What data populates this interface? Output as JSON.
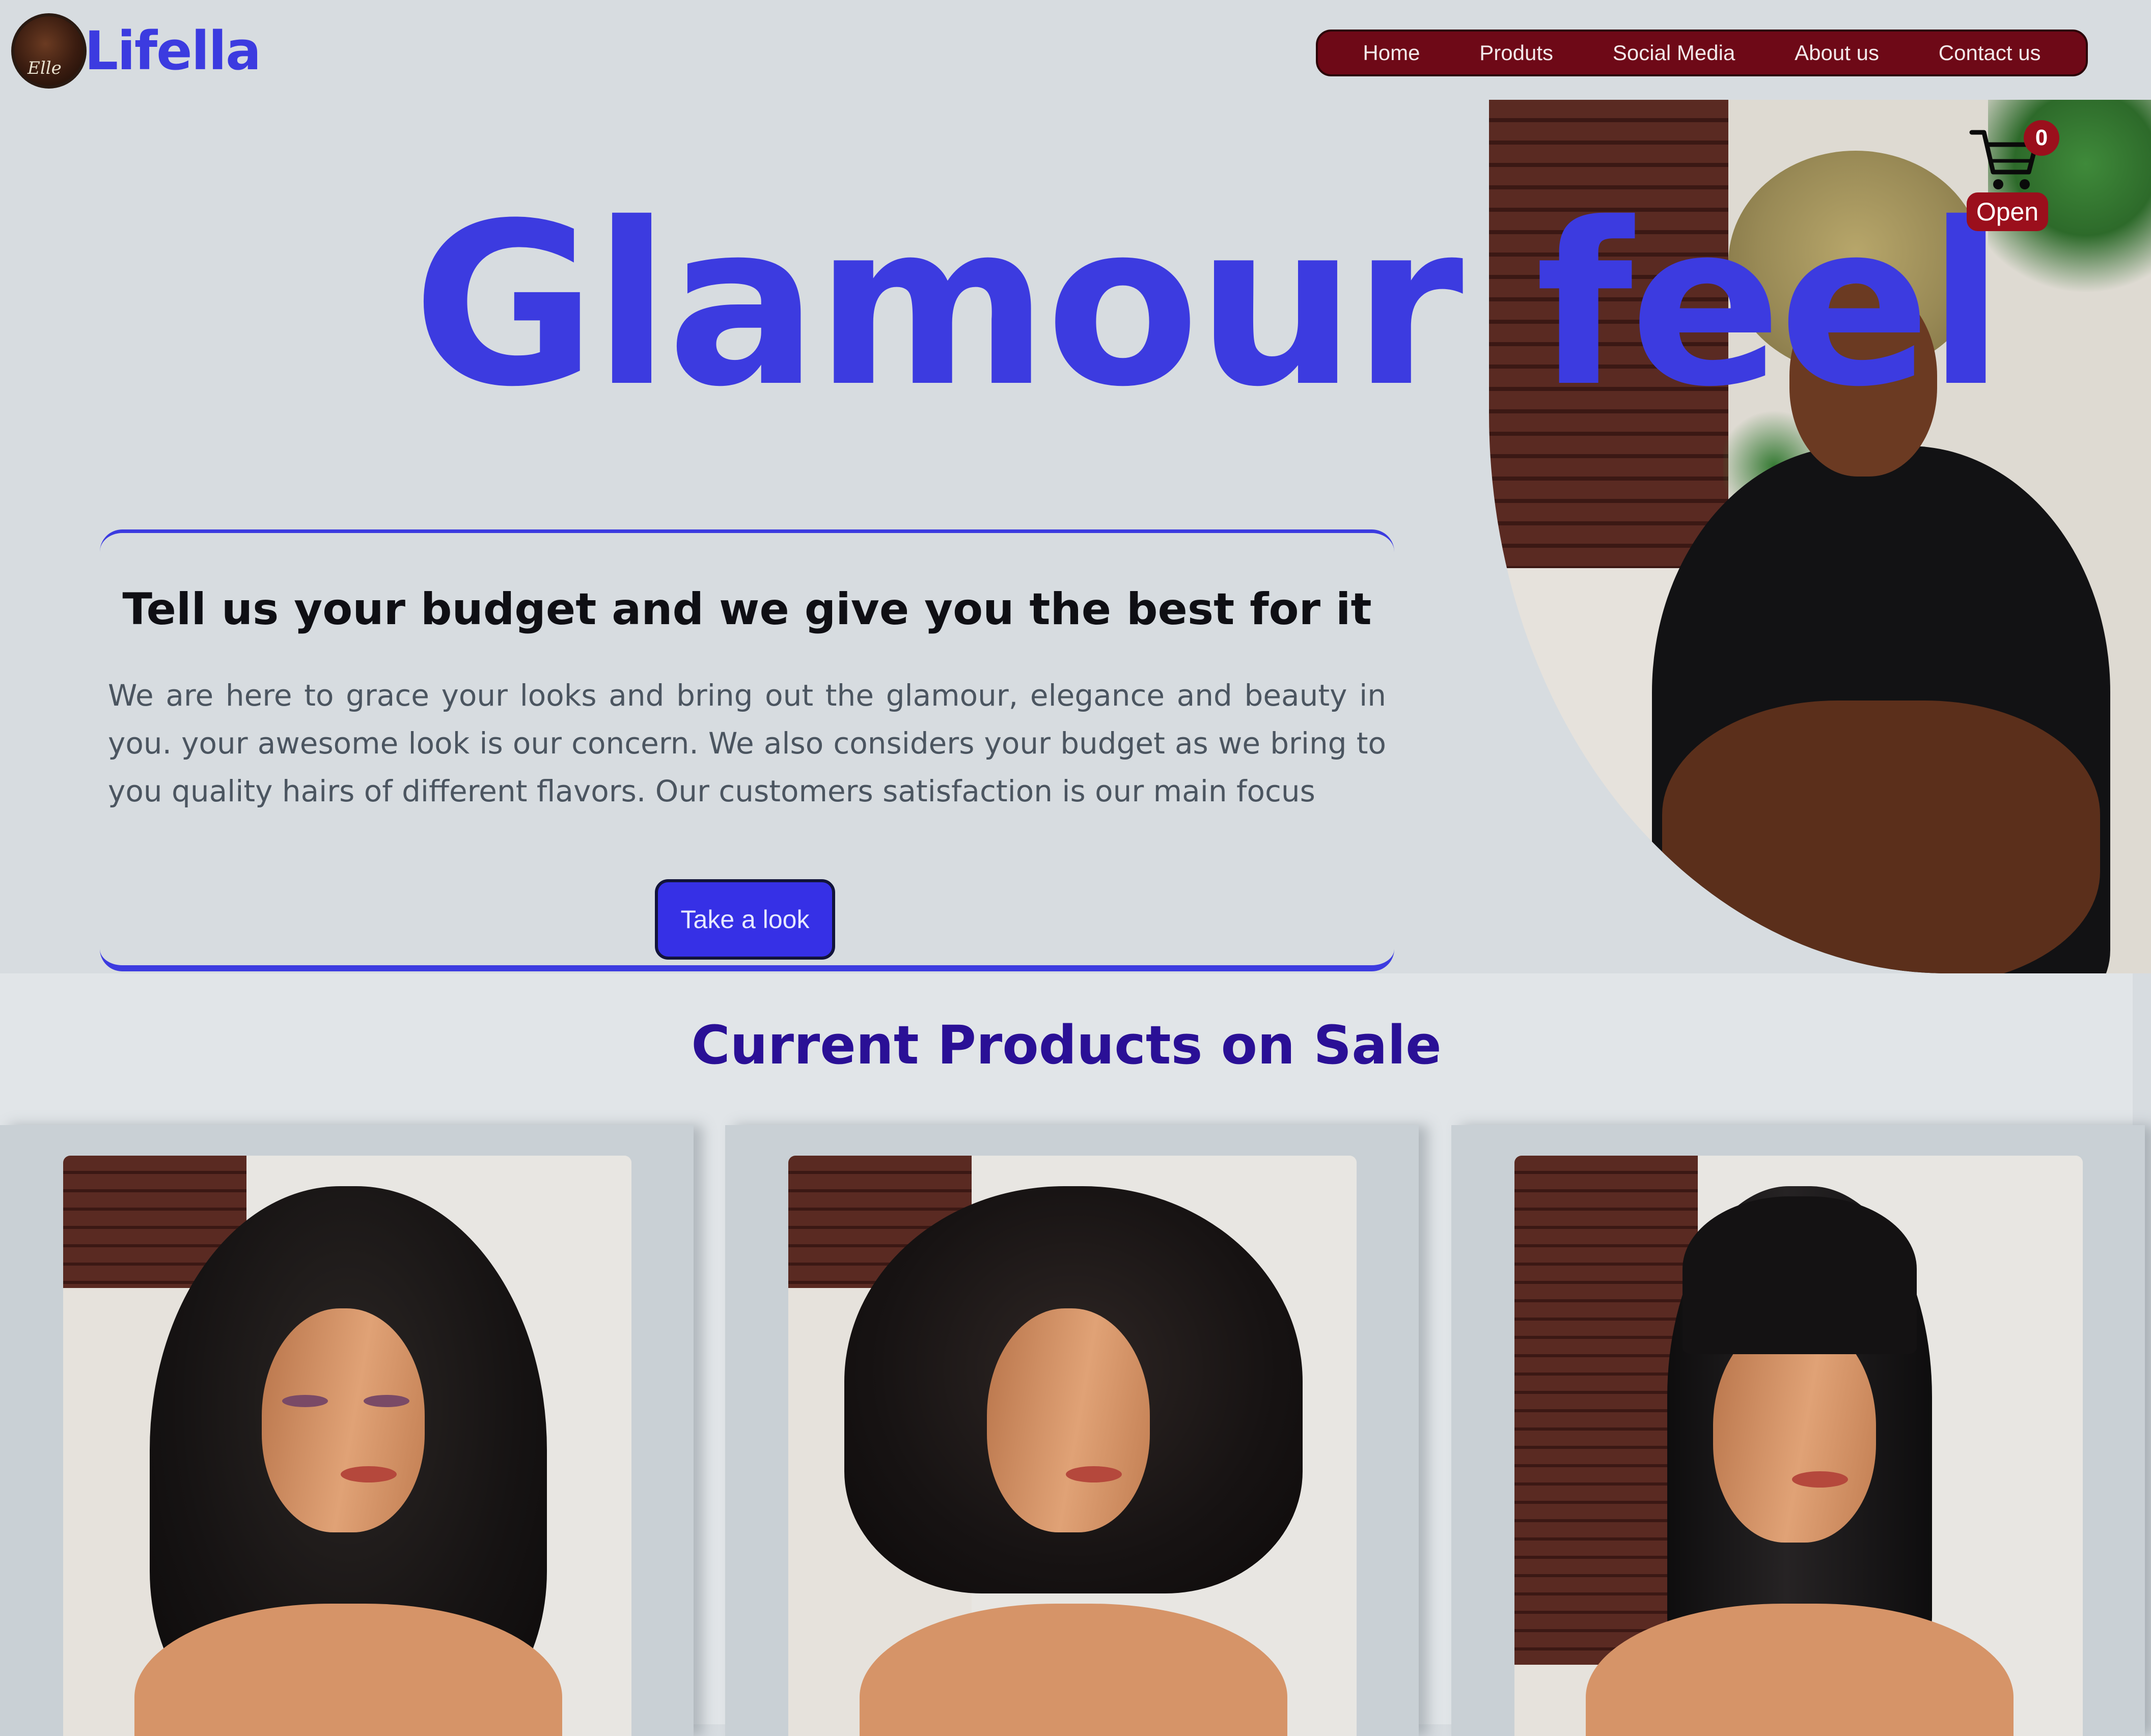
{
  "brand": {
    "logo_script": "Elle",
    "name": "Lifella"
  },
  "nav": {
    "items": [
      {
        "label": "Home"
      },
      {
        "label": "Produts"
      },
      {
        "label": "Social Media"
      },
      {
        "label": "About us"
      },
      {
        "label": "Contact us"
      }
    ]
  },
  "cart": {
    "count": "0",
    "open_label": "Open"
  },
  "hero": {
    "title": "Glamour feel"
  },
  "budget_card": {
    "heading": "Tell us your budget and we give you the best for it",
    "body": "We are here to grace your looks and bring out the glamour, elegance and beauty in you. your awesome look is our concern. We also considers your budget as we bring to you quality hairs of different flavors. Our customers satisfaction is our main focus",
    "button_label": "Take a look"
  },
  "products": {
    "heading": "Current Products on Sale",
    "items": [
      {
        "image": "curly-black-wig-mannequin"
      },
      {
        "image": "curly-bob-fringe-wig-mannequin"
      },
      {
        "image": "straight-black-bangs-wig-mannequin"
      }
    ]
  },
  "colors": {
    "brand_blue": "#3c3be0",
    "nav_maroon": "#6e0917",
    "badge_red": "#9b0f1c",
    "button_blue": "#3630e6",
    "products_heading": "#2a1096"
  }
}
